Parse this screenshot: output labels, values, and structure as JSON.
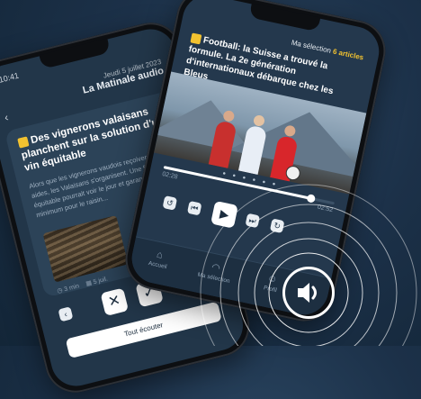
{
  "left_phone": {
    "status_time": "10:41",
    "header_subtitle": "Jeudi 5 juillet 2023",
    "header_title": "La Matinale audio",
    "back_icon": "chevron-left-icon",
    "card_title": "Des vignerons valaisans planchent sur la solution d'un vin équitable",
    "card_text": "Alors que les vignerons vaudois reçoivent des aides, les Valaisans s'organisent. Une filière équitable pourrait voir le jour et garantir un prix minimum pour le raisin...",
    "card_meta_duration": "3 min",
    "card_meta_date": "5 juil.",
    "action_dismiss_icon": "close-icon",
    "action_check_icon": "check-icon",
    "cta_label": "Tout écouter",
    "accent_color": "#f2c230"
  },
  "right_phone": {
    "header_prefix": "Ma sélection",
    "header_count": "6 articles",
    "article_title": "Football: la Suisse a trouvé la formule. La 2e génération d'internationaux débarque chez les Bleus",
    "progress_fraction": 0.86,
    "time_elapsed": "02:28",
    "time_total": "02:52",
    "controls": {
      "rewind_icon": "rewind-10-icon",
      "prev_icon": "previous-icon",
      "play_icon": "play-icon",
      "next_icon": "next-icon",
      "forward_icon": "forward-10-icon"
    },
    "tabs": [
      {
        "icon": "home-icon",
        "label": "Accueil"
      },
      {
        "icon": "headphones-icon",
        "label": "Ma sélection"
      },
      {
        "icon": "user-icon",
        "label": "Profil"
      }
    ]
  },
  "overlay": {
    "sound_icon": "speaker-icon",
    "ring_color": "#ffffff"
  }
}
